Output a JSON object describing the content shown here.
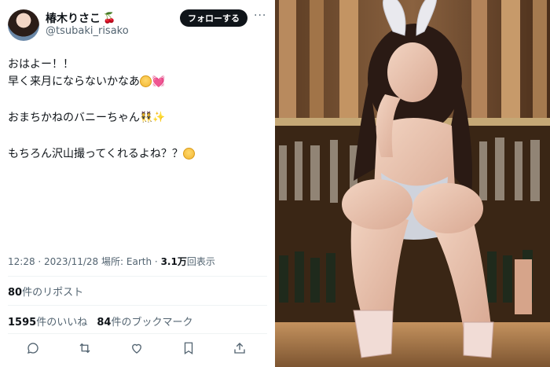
{
  "header": {
    "display_name": "椿木りさこ",
    "name_emoji": "🍒",
    "handle": "@tsubaki_risako",
    "follow_label": "フォローする",
    "more_label": "···"
  },
  "tweet": {
    "line1": "おはよー！！",
    "line2": "早く来月にならないかなあ",
    "line3": "おまちかねのバニーちゃん",
    "line4": "もちろん沢山撮ってくれるよね？？",
    "heart_emoji": "💓",
    "bunny_emoji": "👯",
    "sparkle_emoji": "✨"
  },
  "meta": {
    "time_date": "12:28 · 2023/11/28",
    "location_label": "場所: Earth",
    "views_count": "3.1万",
    "views_label": "回表示"
  },
  "stats": {
    "reposts_count": "80",
    "reposts_label": "件のリポスト",
    "likes_count": "1595",
    "likes_label": "件のいいね",
    "bookmarks_count": "84",
    "bookmarks_label": "件のブックマーク"
  },
  "icons": [
    "reply-icon",
    "repost-icon",
    "like-icon",
    "bookmark-icon",
    "share-icon"
  ]
}
